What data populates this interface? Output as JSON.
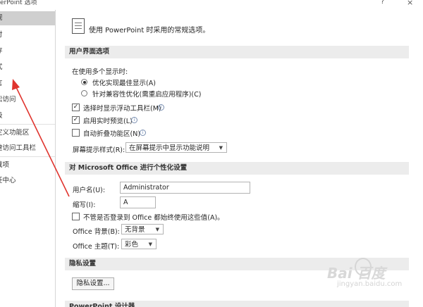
{
  "window": {
    "title": "erPoint 选项",
    "help_label": "?",
    "close_label": "×"
  },
  "sidebar": {
    "items": [
      {
        "label": "规"
      },
      {
        "label": "对"
      },
      {
        "label": "存"
      },
      {
        "label": "式"
      },
      {
        "label": "言"
      },
      {
        "label": "松访问"
      },
      {
        "label": "级"
      },
      {
        "label": "定义功能区"
      },
      {
        "label": "速访问工具栏"
      },
      {
        "label": "载项"
      },
      {
        "label": "任中心"
      }
    ],
    "selected_index": 0
  },
  "main": {
    "intro_text": "使用 PowerPoint 时采用的常规选项。",
    "ui_section": {
      "header": "用户界面选项",
      "multi_display_label": "在使用多个显示时:",
      "radio_optimize": "优化实现最佳显示(A)",
      "radio_compat": "针对兼容性优化(需重启应用程序)(C)",
      "chk_minitoolbar": "选择时显示浮动工具栏(M)",
      "chk_livepreview": "启用实时预览(L)",
      "chk_collapse_ribbon": "自动折叠功能区(N)",
      "tooltip_style_label": "屏幕提示样式(R):",
      "tooltip_style_value": "在屏幕提示中显示功能说明",
      "info_glyph": "i",
      "check_glyph": "✓"
    },
    "personalize_section": {
      "header": "对 Microsoft Office 进行个性化设置",
      "username_label": "用户名(U):",
      "username_value": "Administrator",
      "initials_label": "缩写(I):",
      "initials_value": "A",
      "always_use_label": "不管是否登录到 Office 都始终使用这些值(A)。",
      "background_label": "Office 背景(B):",
      "background_value": "无背景",
      "theme_label": "Office 主题(T):",
      "theme_value": "彩色"
    },
    "privacy_section": {
      "header": "隐私设置",
      "button_label": "隐私设置..."
    },
    "designer_section": {
      "header": "PowerPoint 设计器"
    }
  },
  "watermark": {
    "brand": "Bai 百度",
    "sub": "jingyan.baidu.com"
  },
  "colors": {
    "annotation_arrow": "#e0342e",
    "sidebar_selected": "#cfcfcf",
    "section_header_bg": "#ececec"
  }
}
